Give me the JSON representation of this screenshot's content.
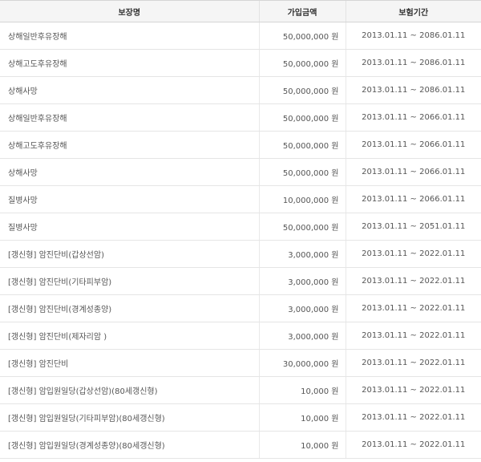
{
  "table": {
    "headers": {
      "name": "보장명",
      "amount": "가입금액",
      "period": "보험기간"
    },
    "rows": [
      {
        "name": "상해일반후유장해",
        "amount": "50,000,000 원",
        "period": "2013.01.11 ~ 2086.01.11"
      },
      {
        "name": "상해고도후유장해",
        "amount": "50,000,000 원",
        "period": "2013.01.11 ~ 2086.01.11"
      },
      {
        "name": "상해사망",
        "amount": "50,000,000 원",
        "period": "2013.01.11 ~ 2086.01.11"
      },
      {
        "name": "상해일반후유장해",
        "amount": "50,000,000 원",
        "period": "2013.01.11 ~ 2066.01.11"
      },
      {
        "name": "상해고도후유장해",
        "amount": "50,000,000 원",
        "period": "2013.01.11 ~ 2066.01.11"
      },
      {
        "name": "상해사망",
        "amount": "50,000,000 원",
        "period": "2013.01.11 ~ 2066.01.11"
      },
      {
        "name": "질병사망",
        "amount": "10,000,000 원",
        "period": "2013.01.11 ~ 2066.01.11"
      },
      {
        "name": "질병사망",
        "amount": "50,000,000 원",
        "period": "2013.01.11 ~ 2051.01.11"
      },
      {
        "name": "[갱신형] 암진단비(갑상선암)",
        "amount": "3,000,000 원",
        "period": "2013.01.11 ~ 2022.01.11"
      },
      {
        "name": "[갱신형] 암진단비(기타피부암)",
        "amount": "3,000,000 원",
        "period": "2013.01.11 ~ 2022.01.11"
      },
      {
        "name": "[갱신형] 암진단비(경계성종양)",
        "amount": "3,000,000 원",
        "period": "2013.01.11 ~ 2022.01.11"
      },
      {
        "name": "[갱신형] 암진단비(제자리암 )",
        "amount": "3,000,000 원",
        "period": "2013.01.11 ~ 2022.01.11"
      },
      {
        "name": "[갱신형] 암진단비",
        "amount": "30,000,000 원",
        "period": "2013.01.11 ~ 2022.01.11"
      },
      {
        "name": "[갱신형] 암입원일당(갑상선암)(80세갱신형)",
        "amount": "10,000 원",
        "period": "2013.01.11 ~ 2022.01.11"
      },
      {
        "name": "[갱신형] 암입원일당(기타피부암)(80세갱신형)",
        "amount": "10,000 원",
        "period": "2013.01.11 ~ 2022.01.11"
      },
      {
        "name": "[갱신형] 암입원일당(경계성종양)(80세갱신형)",
        "amount": "10,000 원",
        "period": "2013.01.11 ~ 2022.01.11"
      }
    ]
  }
}
